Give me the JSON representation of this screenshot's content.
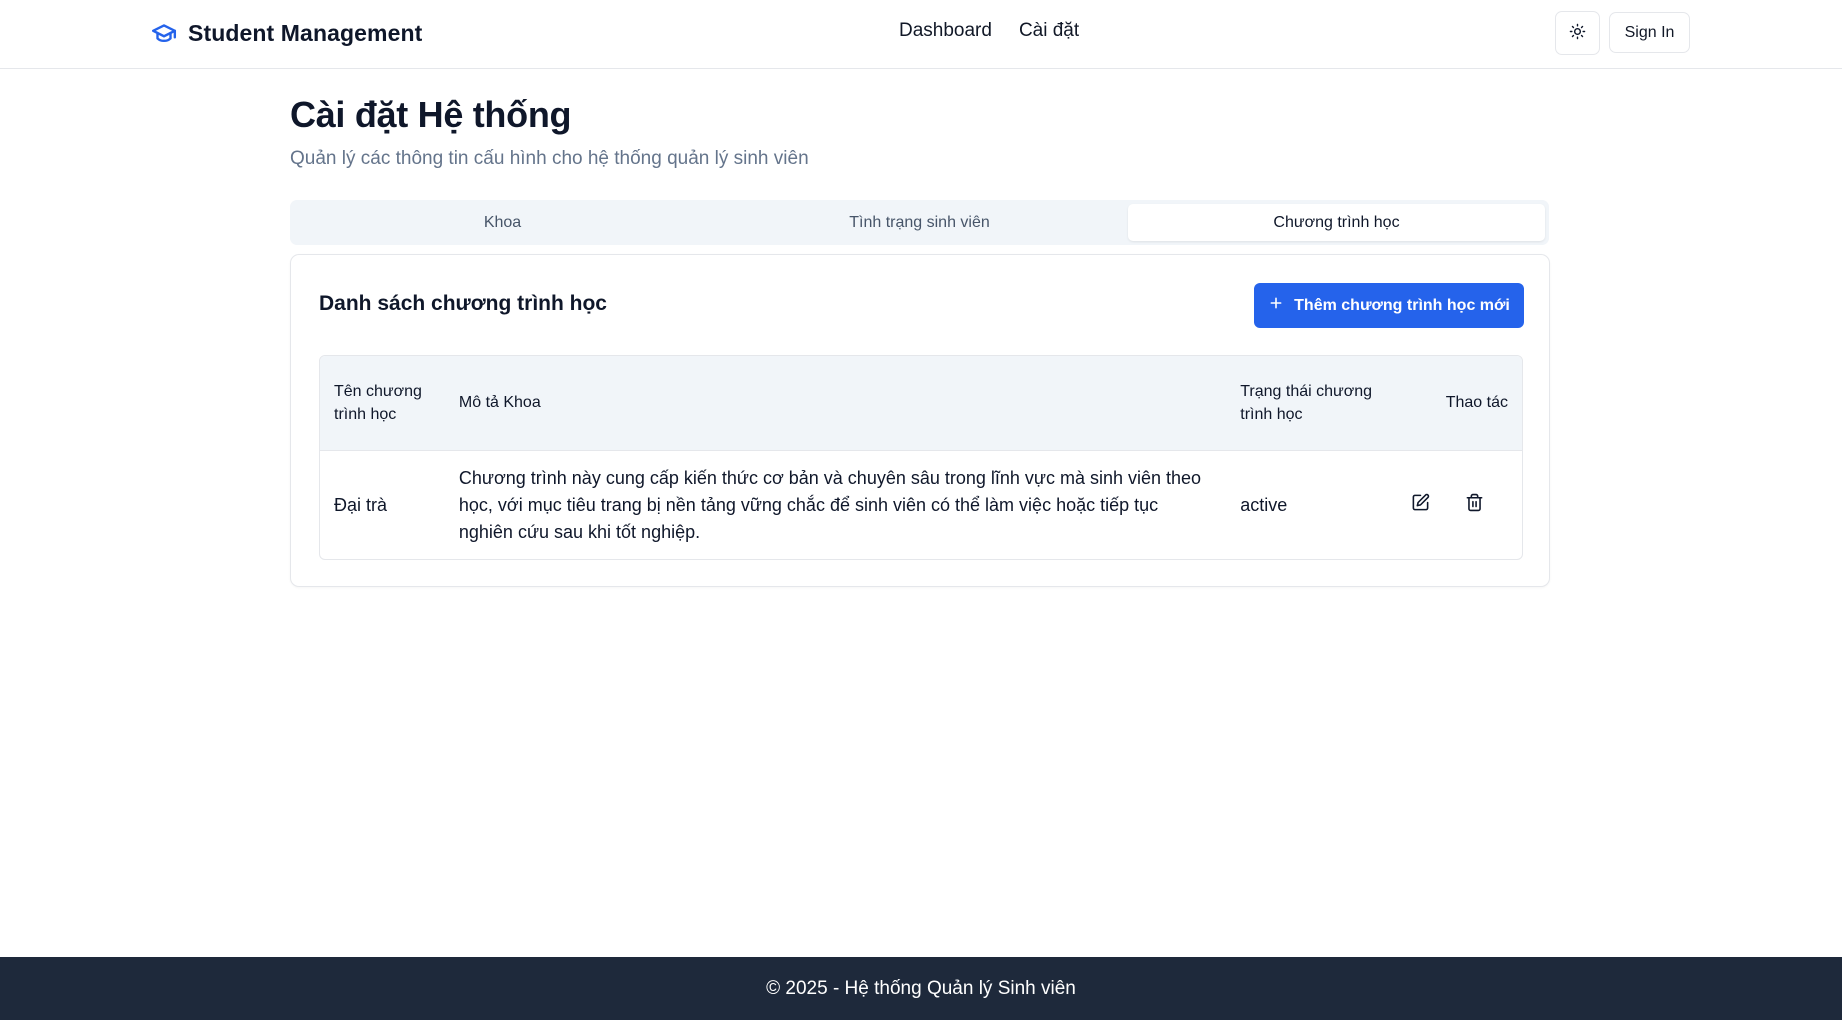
{
  "navbar": {
    "brand_icon": "graduation-cap-icon",
    "brand_title": "Student Management",
    "links": [
      "Dashboard",
      "Cài đặt"
    ],
    "theme_icon": "sun-icon",
    "signin_label": "Sign In"
  },
  "page": {
    "title": "Cài đặt Hệ thống",
    "subtitle": "Quản lý các thông tin cấu hình cho hệ thống quản lý sinh viên"
  },
  "tabs": [
    {
      "label": "Khoa",
      "active": false
    },
    {
      "label": "Tình trạng sinh viên",
      "active": false
    },
    {
      "label": "Chương trình học",
      "active": true
    }
  ],
  "card": {
    "title": "Danh sách chương trình học",
    "add_icon": "plus-icon",
    "add_label": "Thêm chương trình học mới"
  },
  "table": {
    "headers": [
      "Tên chương trình học",
      "Mô tả Khoa",
      "Trạng thái chương trình học",
      "Thao tác"
    ],
    "rows": [
      {
        "name": "Đại trà",
        "description": "Chương trình này cung cấp kiến thức cơ bản và chuyên sâu trong lĩnh vực mà sinh viên theo học, với mục tiêu trang bị nền tảng vững chắc để sinh viên có thể làm việc hoặc tiếp tục nghiên cứu sau khi tốt nghiệp.",
        "status": "active",
        "edit_icon": "edit-icon",
        "delete_icon": "trash-icon"
      }
    ]
  },
  "footer": {
    "text": "© 2025 - Hệ thống Quản lý Sinh viên"
  },
  "colors": {
    "accent": "#2563eb",
    "footer_bg": "#1e293b",
    "tab_bg": "#f1f5f9",
    "muted_text": "#64748b"
  }
}
